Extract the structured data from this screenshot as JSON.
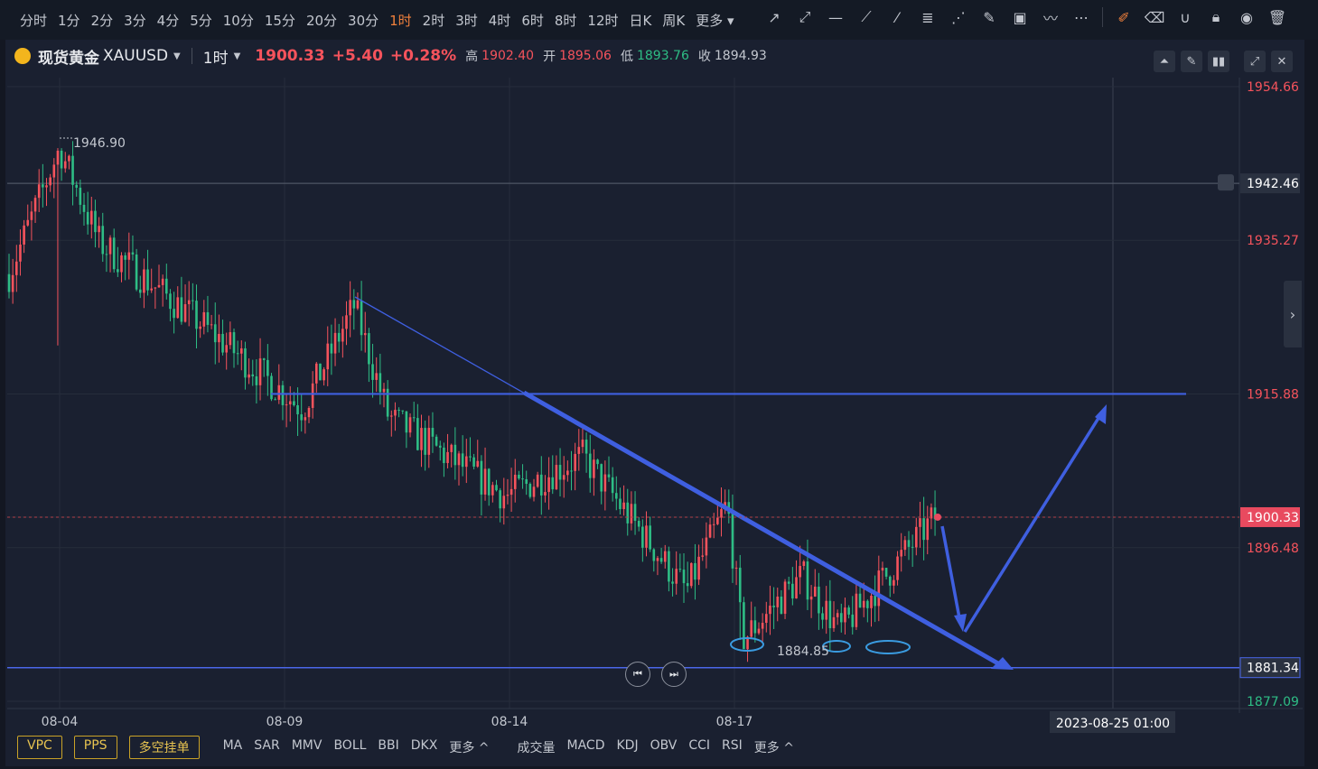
{
  "toolbar": {
    "intervals": [
      "分时",
      "1分",
      "2分",
      "3分",
      "4分",
      "5分",
      "10分",
      "15分",
      "20分",
      "30分",
      "1时",
      "2时",
      "3时",
      "4时",
      "6时",
      "8时",
      "12时",
      "日K",
      "周K",
      "更多"
    ],
    "active_interval": "1时"
  },
  "instrument": {
    "name": "现货黄金",
    "code": "XAUUSD",
    "timeframe": "1时",
    "price": "1900.33",
    "change": "+5.40",
    "change_pct": "+0.28%",
    "high_label": "高",
    "high": "1902.40",
    "open_label": "开",
    "open": "1895.06",
    "low_label": "低",
    "low": "1893.76",
    "close_label": "收",
    "close": "1894.93"
  },
  "indicators": {
    "pills": [
      "VPC",
      "PPS",
      "多空挂单"
    ],
    "main": [
      "MA",
      "SAR",
      "MMV",
      "BOLL",
      "BBI",
      "DKX",
      "更多 ^"
    ],
    "sub": [
      "成交量",
      "MACD",
      "KDJ",
      "OBV",
      "CCI",
      "RSI",
      "更多 ^"
    ]
  },
  "colors": {
    "up": "#f5535c",
    "down": "#2ebd85",
    "drawing": "#3f5fe0",
    "background": "#1a2030",
    "accent": "#f0803c"
  },
  "icons": [
    "trend-line-icon",
    "ray-icon",
    "horizontal-line-icon",
    "segment-icon",
    "extended-line-icon",
    "fibonacci-icon",
    "fan-icon",
    "brush-icon",
    "image-icon",
    "pattern-icon",
    "more-tools-icon",
    "edit-icon",
    "eraser-icon",
    "magnet-icon",
    "lock-icon",
    "eye-icon",
    "trash-icon"
  ],
  "chart_data": {
    "type": "candlestick",
    "timeframe": "1H",
    "y_labels": [
      "1954.66",
      "1942.46",
      "1935.27",
      "1915.88",
      "1900.33",
      "1896.48",
      "1881.34",
      "1877.09"
    ],
    "ylim": [
      1875,
      1957
    ],
    "x_labels": [
      "08-04",
      "08-09",
      "08-14",
      "08-17"
    ],
    "crosshair_time": "2023-08-25 01:00",
    "current_price": 1900.33,
    "annotations": {
      "high_marker": "1946.90",
      "low_marker": "1884.85"
    },
    "key_levels": [
      1942.46,
      1915.88,
      1881.34
    ],
    "grid": true,
    "series_up_color": "#f5535c",
    "series_down_color": "#2ebd85",
    "approx_swing_points": [
      {
        "x": "08-04",
        "price": 1931
      },
      {
        "x": "08-04",
        "price": 1946.9
      },
      {
        "x": "08-07",
        "price": 1935
      },
      {
        "x": "08-08",
        "price": 1925
      },
      {
        "x": "08-09",
        "price": 1914
      },
      {
        "x": "08-10",
        "price": 1927
      },
      {
        "x": "08-11",
        "price": 1913
      },
      {
        "x": "08-14",
        "price": 1903
      },
      {
        "x": "08-15",
        "price": 1908
      },
      {
        "x": "08-16",
        "price": 1891
      },
      {
        "x": "08-17",
        "price": 1902
      },
      {
        "x": "08-17",
        "price": 1884.85
      },
      {
        "x": "08-18",
        "price": 1893
      },
      {
        "x": "08-21",
        "price": 1886
      },
      {
        "x": "08-22",
        "price": 1900.33
      }
    ]
  }
}
